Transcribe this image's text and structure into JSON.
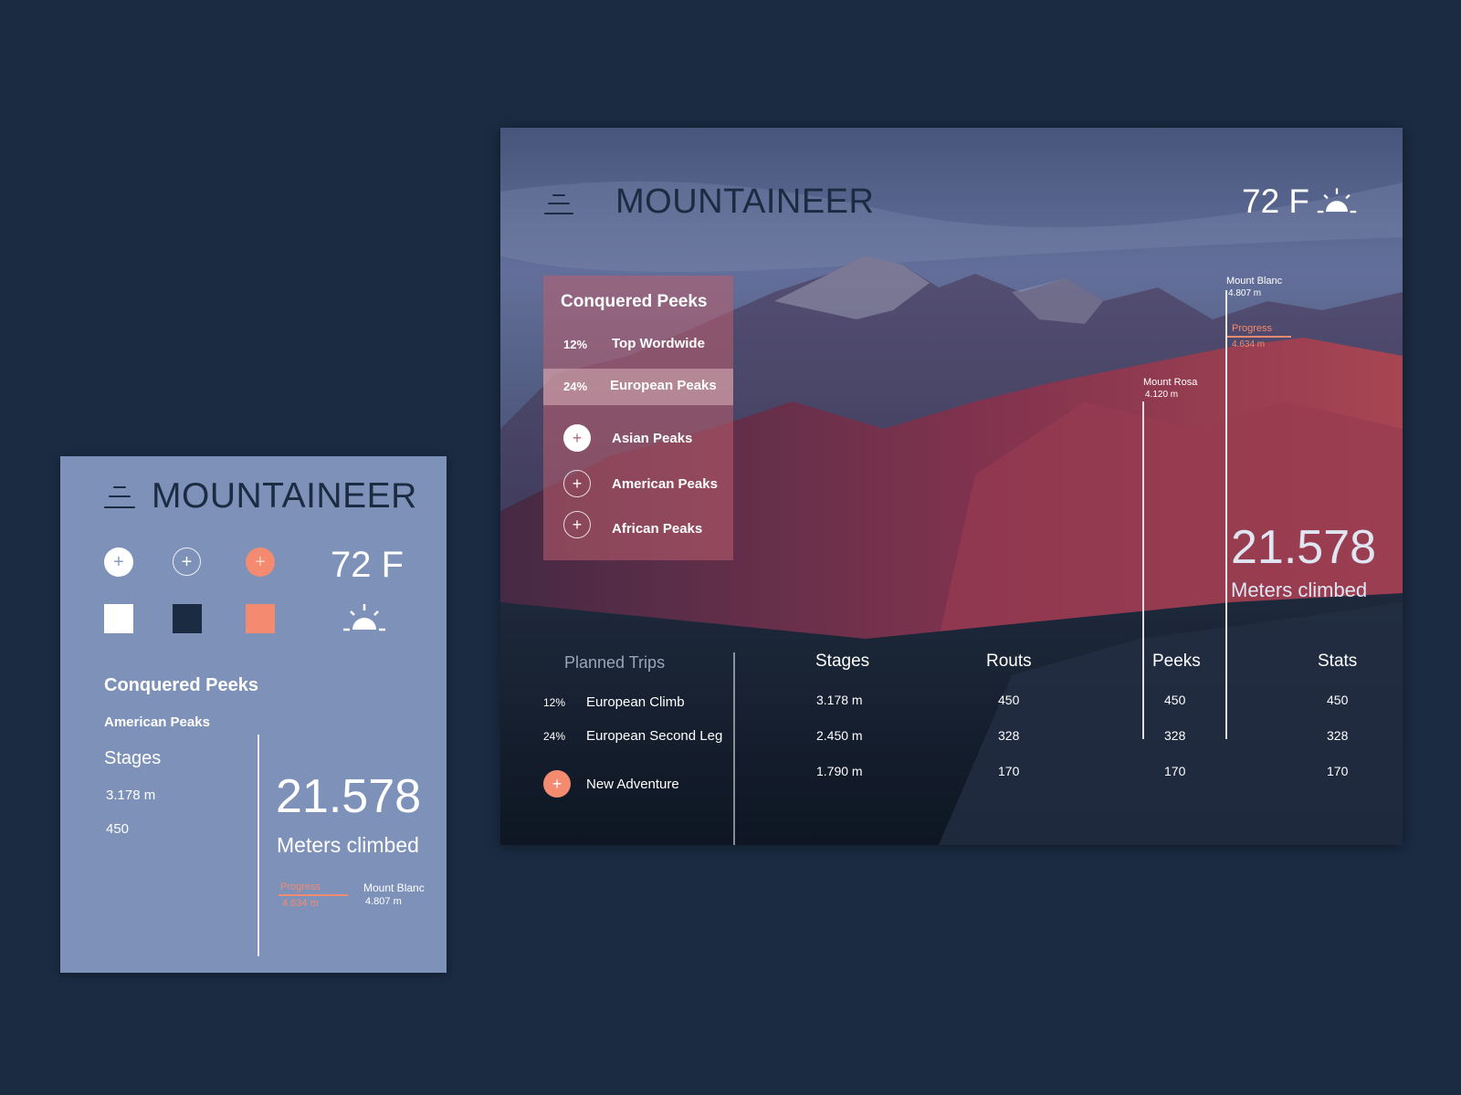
{
  "app": {
    "name": "MOUNTAINEER"
  },
  "colors": {
    "white": "#ffffff",
    "navy": "#1b2b42",
    "coral": "#f48a70",
    "panel_bg": "#7e92b9"
  },
  "style_guide": {
    "title": "MOUNTAINEER",
    "temperature": "72 F",
    "weather_icon": "sunrise-icon",
    "buttons": [
      {
        "icon": "plus-icon",
        "glyph": "+",
        "style": "white"
      },
      {
        "icon": "plus-icon",
        "glyph": "+",
        "style": "outline"
      },
      {
        "icon": "plus-icon",
        "glyph": "+",
        "style": "coral"
      }
    ],
    "heading": "Conquered Peeks",
    "subheading": "American Peaks",
    "stages_label": "Stages",
    "stage_values": [
      "3.178 m",
      "450"
    ],
    "big_number": "21.578",
    "big_label": "Meters climbed",
    "progress_label": "Progress",
    "progress_value": "4.634 m",
    "peak_name": "Mount Blanc",
    "peak_height": "4.807 m"
  },
  "dashboard": {
    "title": "MOUNTAINEER",
    "temperature": "72 F",
    "weather_icon": "sunrise-icon",
    "menu_icon": "menu-icon",
    "conquered": {
      "title": "Conquered Peeks",
      "ranked": [
        {
          "pct": "12%",
          "label": "Top Wordwide",
          "active": false
        },
        {
          "pct": "24%",
          "label": "European Peaks",
          "active": true
        }
      ],
      "add_items": [
        {
          "label": "Asian Peaks",
          "style": "solid"
        },
        {
          "label": "American Peaks",
          "style": "outline"
        },
        {
          "label": "African Peaks",
          "style": "outline"
        }
      ],
      "add_glyph": "+"
    },
    "markers": {
      "blanc": {
        "name": "Mount Blanc",
        "height": "4.807 m"
      },
      "rosa": {
        "name": "Mount Rosa",
        "height": "4.120 m"
      },
      "progress": {
        "label": "Progress",
        "value": "4.634 m"
      }
    },
    "big_number": "21.578",
    "big_label": "Meters climbed",
    "trips": {
      "title": "Planned Trips",
      "rows": [
        {
          "pct": "12%",
          "name": "European Climb"
        },
        {
          "pct": "24%",
          "name": "European Second Leg"
        }
      ],
      "new_label": "New Adventure",
      "new_glyph": "+"
    },
    "table": {
      "headers": [
        "Stages",
        "Routs",
        "Peeks",
        "Stats"
      ],
      "rows": [
        [
          "3.178 m",
          "450",
          "450",
          "450"
        ],
        [
          "2.450 m",
          "328",
          "328",
          "328"
        ],
        [
          "1.790 m",
          "170",
          "170",
          "170"
        ]
      ]
    }
  }
}
